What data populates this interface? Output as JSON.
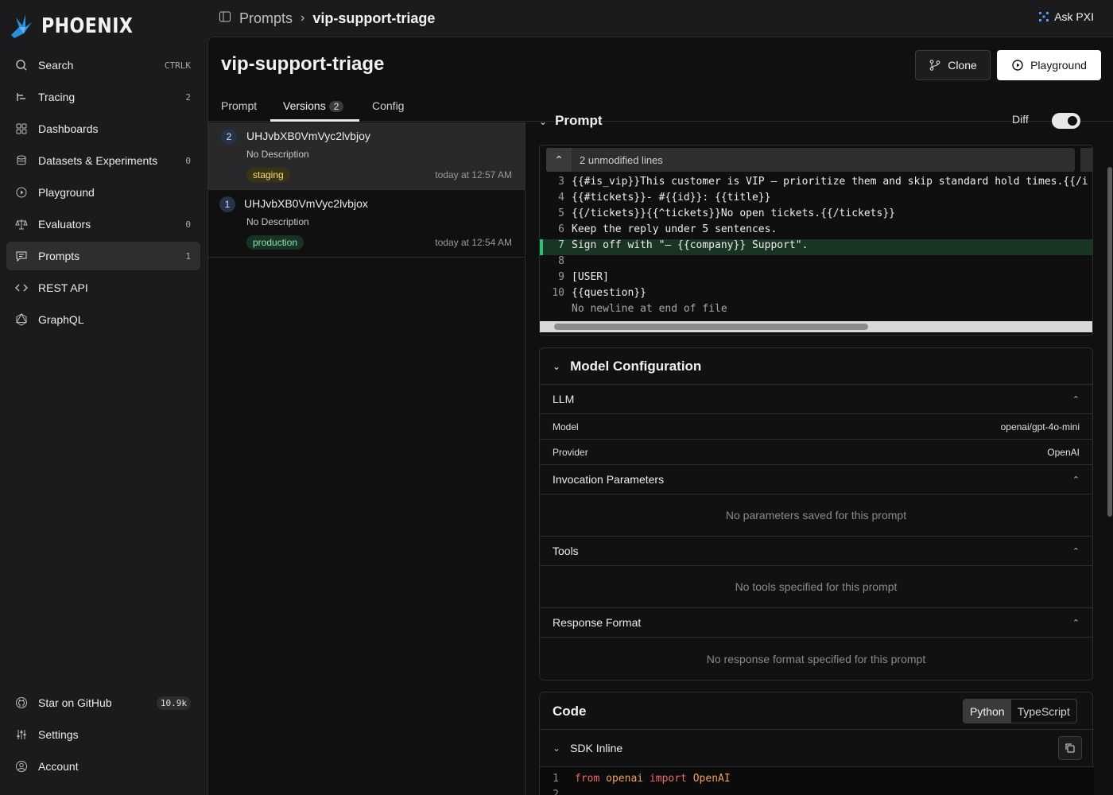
{
  "sidebar": {
    "logo_text": "PHOENIX",
    "items": [
      {
        "label": "Search",
        "count": "CTRLK",
        "icon": "search-icon"
      },
      {
        "label": "Tracing",
        "count": "2",
        "icon": "tracing-icon"
      },
      {
        "label": "Dashboards",
        "count": "",
        "icon": "dashboard-icon"
      },
      {
        "label": "Datasets & Experiments",
        "count": "0",
        "icon": "database-icon"
      },
      {
        "label": "Playground",
        "count": "",
        "icon": "play-icon"
      },
      {
        "label": "Evaluators",
        "count": "0",
        "icon": "scale-icon"
      },
      {
        "label": "Prompts",
        "count": "1",
        "icon": "chat-icon"
      },
      {
        "label": "REST API",
        "count": "",
        "icon": "code-icon"
      },
      {
        "label": "GraphQL",
        "count": "",
        "icon": "graphql-icon"
      }
    ],
    "bottom": [
      {
        "label": "Star on GitHub",
        "badge": "10.9k",
        "icon": "github-icon"
      },
      {
        "label": "Settings",
        "icon": "settings-icon"
      },
      {
        "label": "Account",
        "icon": "account-icon"
      }
    ]
  },
  "topbar": {
    "breadcrumb_root": "Prompts",
    "breadcrumb_current": "vip-support-triage",
    "ask_label": "Ask PXI"
  },
  "page": {
    "title": "vip-support-triage",
    "clone_label": "Clone",
    "playground_label": "Playground",
    "tabs": {
      "prompt": "Prompt",
      "versions": "Versions",
      "versions_count": "2",
      "config": "Config"
    }
  },
  "versions": [
    {
      "num": "2",
      "id": "UHJvbXB0VmVyc2lvbjoy",
      "desc": "No Description",
      "tag": "staging",
      "time": "today at 12:57 AM"
    },
    {
      "num": "1",
      "id": "UHJvbXB0VmVyc2lvbjox",
      "desc": "No Description",
      "tag": "production",
      "time": "today at 12:54 AM"
    }
  ],
  "prompt_diff": {
    "header": "Prompt",
    "diff_label": "Diff",
    "unmodified": "2 unmodified lines",
    "lines": [
      {
        "n": "3",
        "text": "{{#is_vip}}This customer is VIP — prioritize them and skip standard hold times.{{/i"
      },
      {
        "n": "4",
        "text": "{{#tickets}}- #{{id}}: {{title}}"
      },
      {
        "n": "5",
        "text": "{{/tickets}}{{^tickets}}No open tickets.{{/tickets}}"
      },
      {
        "n": "6",
        "text": "Keep the reply under 5 sentences."
      },
      {
        "n": "7",
        "text": "Sign off with \"— {{company}} Support\"."
      },
      {
        "n": "8",
        "text": ""
      },
      {
        "n": "9",
        "text": "[USER]"
      },
      {
        "n": "10",
        "text": "{{question}}"
      },
      {
        "n": "",
        "text": "No newline at end of file"
      }
    ]
  },
  "model_config": {
    "title": "Model Configuration",
    "llm": "LLM",
    "model_key": "Model",
    "model_val": "openai/gpt-4o-mini",
    "provider_key": "Provider",
    "provider_val": "OpenAI",
    "invocation": "Invocation Parameters",
    "invocation_empty": "No parameters saved for this prompt",
    "tools": "Tools",
    "tools_empty": "No tools specified for this prompt",
    "response": "Response Format",
    "response_empty": "No response format specified for this prompt"
  },
  "code": {
    "title": "Code",
    "python": "Python",
    "typescript": "TypeScript",
    "sdk": "SDK Inline",
    "line1_from": "from",
    "line1_mod": "openai",
    "line1_import": "import",
    "line1_name": "OpenAI"
  },
  "colors": {
    "accent": "#2bbf78",
    "staging": "#f5dc80",
    "production": "#8fe0b0"
  }
}
